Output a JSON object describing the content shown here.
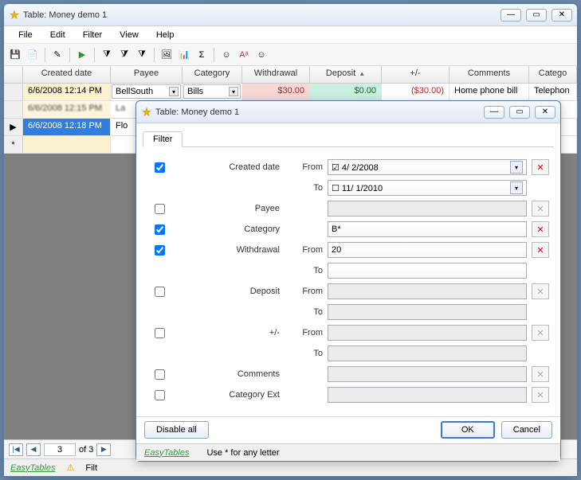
{
  "main": {
    "title": "Table: Money demo 1",
    "menu": {
      "file": "File",
      "edit": "Edit",
      "filter": "Filter",
      "view": "View",
      "help": "Help"
    },
    "columns": {
      "created": "Created date",
      "payee": "Payee",
      "category": "Category",
      "withdrawal": "Withdrawal",
      "deposit": "Deposit",
      "pm": "+/-",
      "comments": "Comments",
      "catext": "Catego"
    },
    "rows": [
      {
        "date": "6/6/2008 12:14 PM",
        "payee": "BellSouth",
        "category": "Bills",
        "withdrawal": "$30.00",
        "deposit": "$0.00",
        "pm": "($30.00)",
        "comments": "Home phone bill",
        "catext": "Telephon"
      },
      {
        "date": "6/6/2008 12:15 PM",
        "payee": "La",
        "category": "",
        "withdrawal": "",
        "deposit": "",
        "pm": "",
        "comments": "",
        "catext": ""
      },
      {
        "date": "6/6/2008 12:18 PM",
        "payee": "Flo",
        "category": "",
        "withdrawal": "",
        "deposit": "",
        "pm": "",
        "comments": "",
        "catext": ""
      }
    ],
    "nav": {
      "pos": "3",
      "of": "of 3"
    },
    "status": {
      "brand": "EasyTables",
      "filter_hint": "Filt"
    }
  },
  "dialog": {
    "title": "Table: Money demo 1",
    "tab": "Filter",
    "fields": {
      "created": {
        "label": "Created date",
        "from": "From",
        "to": "To",
        "from_val": "4/  2/2008",
        "to_val": "11/  1/2010",
        "checked": true
      },
      "payee": {
        "label": "Payee",
        "val": "",
        "checked": false
      },
      "category": {
        "label": "Category",
        "val": "B*",
        "checked": true
      },
      "withdrawal": {
        "label": "Withdrawal",
        "from": "From",
        "to": "To",
        "from_val": "20",
        "to_val": "",
        "checked": true
      },
      "deposit": {
        "label": "Deposit",
        "from": "From",
        "to": "To",
        "checked": false
      },
      "pm": {
        "label": "+/-",
        "from": "From",
        "to": "To",
        "checked": false
      },
      "comments": {
        "label": "Comments",
        "checked": false
      },
      "catext": {
        "label": "Category Ext",
        "checked": false
      }
    },
    "buttons": {
      "disable_all": "Disable all",
      "ok": "OK",
      "cancel": "Cancel"
    },
    "status": {
      "brand": "EasyTables",
      "hint": "Use * for any letter"
    }
  }
}
